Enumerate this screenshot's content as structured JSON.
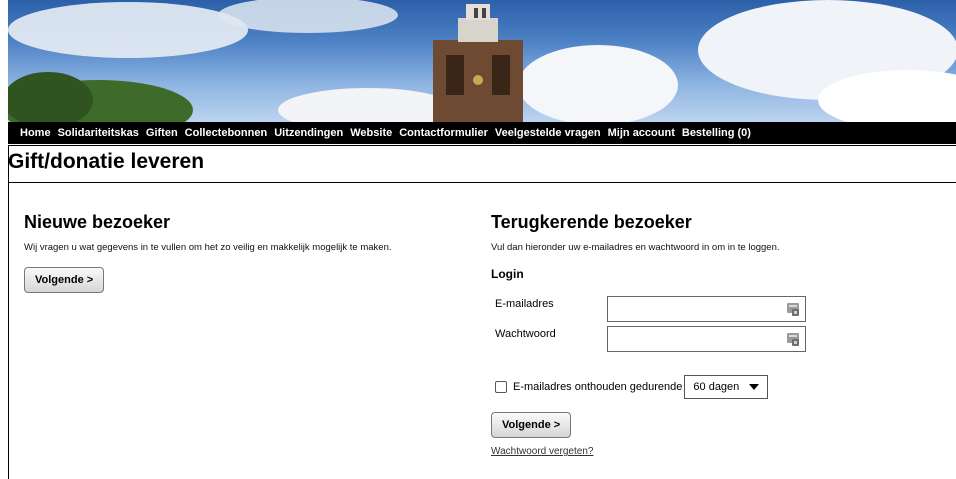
{
  "nav": {
    "items": [
      "Home",
      "Solidariteitskas",
      "Giften",
      "Collectebonnen",
      "Uitzendingen",
      "Website",
      "Contactformulier",
      "Veelgestelde vragen",
      "Mijn account",
      "Bestelling (0)"
    ]
  },
  "page": {
    "title": "Gift/donatie leveren"
  },
  "new_visitor": {
    "heading": "Nieuwe bezoeker",
    "description": "Wij vragen u wat gegevens in te vullen om het zo veilig en makkelijk mogelijk te maken.",
    "button_label": "Volgende >"
  },
  "returning_visitor": {
    "heading": "Terugkerende bezoeker",
    "description": "Vul dan hieronder uw e-mailadres en wachtwoord in om in te loggen.",
    "login_label": "Login",
    "email_label": "E-mailadres",
    "email_value": "",
    "password_label": "Wachtwoord",
    "password_value": "",
    "remember_label": "E-mailadres onthouden gedurende",
    "remember_checked": false,
    "remember_duration": "60 dagen",
    "button_label": "Volgende >",
    "forgot_link": "Wachtwoord vergeten?"
  },
  "icons": {
    "field_icon": "password-manager-icon",
    "select_icon": "chevron-down-icon"
  }
}
